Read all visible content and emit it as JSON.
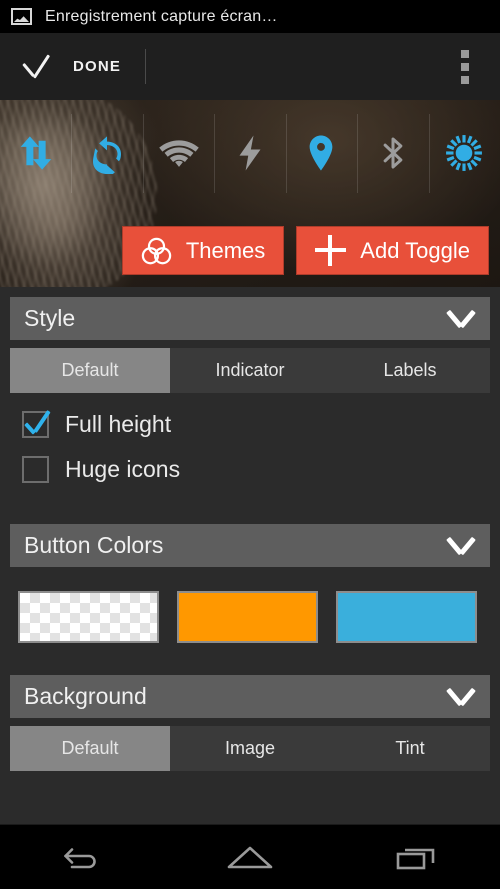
{
  "statusbar": {
    "icon": "photo-icon",
    "title": "Enregistrement capture écran…"
  },
  "actionbar": {
    "check_icon": "checkmark-icon",
    "done_label": "DONE",
    "overflow_icon": "overflow-menu-icon"
  },
  "preview": {
    "toggles": [
      {
        "name": "data-transfer",
        "state": "on",
        "color": "#31ade4"
      },
      {
        "name": "sync",
        "state": "on",
        "color": "#31ade4"
      },
      {
        "name": "wifi",
        "state": "off",
        "color": "#9c9c9c"
      },
      {
        "name": "flash",
        "state": "off",
        "color": "#9c9c9c"
      },
      {
        "name": "location",
        "state": "on",
        "color": "#31ade4"
      },
      {
        "name": "bluetooth",
        "state": "off",
        "color": "#9c9c9c"
      },
      {
        "name": "brightness",
        "state": "on",
        "color": "#31ade4"
      }
    ],
    "themes_button": {
      "label": "Themes",
      "icon": "themes-venn-icon"
    },
    "add_toggle_button": {
      "label": "Add Toggle",
      "icon": "plus-icon"
    },
    "accent_color": "#e8503a"
  },
  "sections": {
    "style": {
      "title": "Style",
      "collapse_icon": "chevron-up-icon",
      "tabs": [
        {
          "label": "Default",
          "active": true
        },
        {
          "label": "Indicator",
          "active": false
        },
        {
          "label": "Labels",
          "active": false
        }
      ],
      "checkboxes": [
        {
          "label": "Full height",
          "checked": true
        },
        {
          "label": "Huge icons",
          "checked": false
        }
      ]
    },
    "button_colors": {
      "title": "Button Colors",
      "collapse_icon": "chevron-up-icon",
      "swatches": [
        {
          "name": "transparent",
          "color": "transparent"
        },
        {
          "name": "orange",
          "color": "#FF9800"
        },
        {
          "name": "blue",
          "color": "#3AAFDC"
        }
      ]
    },
    "background": {
      "title": "Background",
      "collapse_icon": "chevron-up-icon",
      "tabs": [
        {
          "label": "Default",
          "active": true
        },
        {
          "label": "Image",
          "active": false
        },
        {
          "label": "Tint",
          "active": false
        }
      ]
    }
  },
  "navbar": {
    "back": "back-icon",
    "home": "home-icon",
    "recents": "recents-icon"
  }
}
